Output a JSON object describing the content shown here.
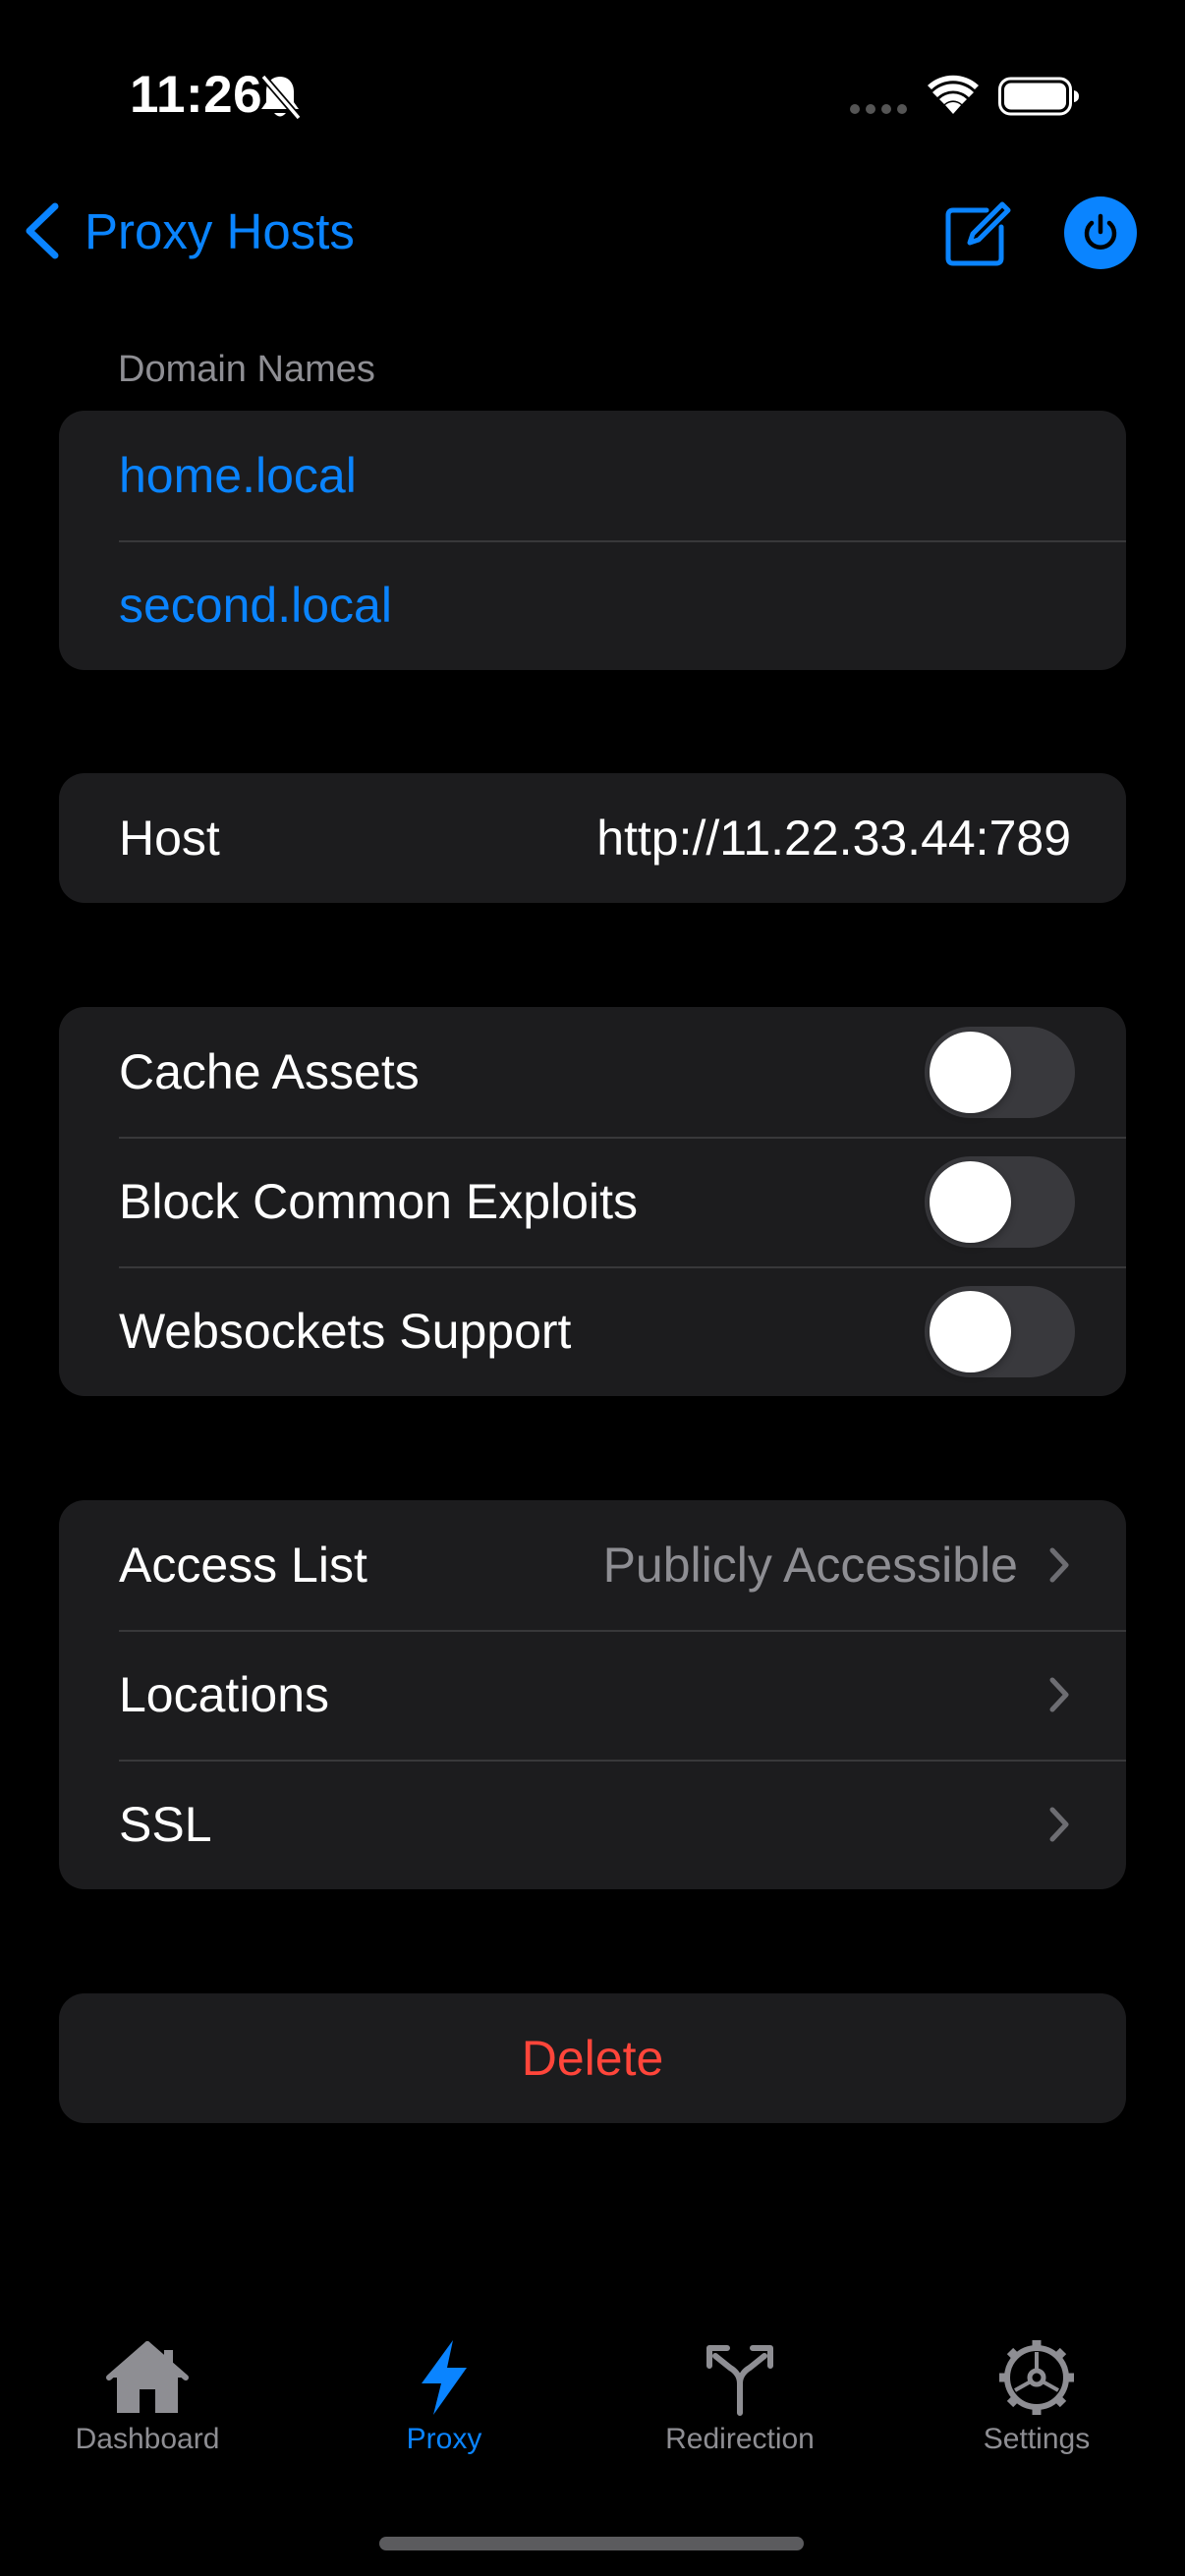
{
  "status_bar": {
    "time": "11:26"
  },
  "nav": {
    "back_label": "Proxy Hosts"
  },
  "domain_section": {
    "header": "Domain Names",
    "domains": [
      "home.local",
      "second.local"
    ]
  },
  "host_section": {
    "label": "Host",
    "value": "http://11.22.33.44:789"
  },
  "toggles": [
    {
      "label": "Cache Assets",
      "on": false
    },
    {
      "label": "Block Common Exploits",
      "on": false
    },
    {
      "label": "Websockets Support",
      "on": false
    }
  ],
  "links": {
    "access_list_label": "Access List",
    "access_list_value": "Publicly Accessible",
    "locations_label": "Locations",
    "ssl_label": "SSL"
  },
  "delete_label": "Delete",
  "tabs": [
    {
      "label": "Dashboard",
      "icon": "house-icon",
      "active": false
    },
    {
      "label": "Proxy",
      "icon": "bolt-icon",
      "active": true
    },
    {
      "label": "Redirection",
      "icon": "split-arrow-icon",
      "active": false
    },
    {
      "label": "Settings",
      "icon": "gear-icon",
      "active": false
    }
  ],
  "colors": {
    "accent": "#0a84ff",
    "destructive": "#ff453a",
    "background": "#000000",
    "cell": "#1c1c1e",
    "secondary_text": "#8e8e93"
  }
}
